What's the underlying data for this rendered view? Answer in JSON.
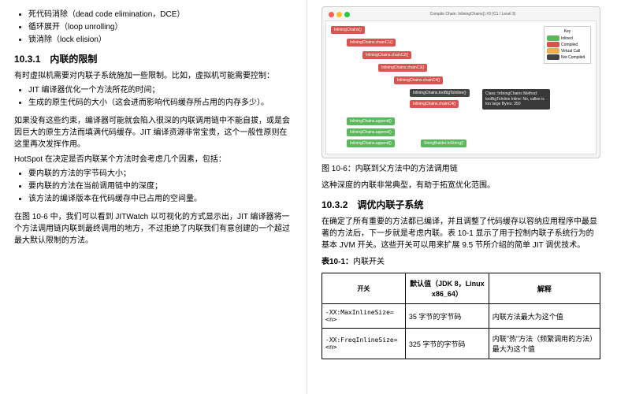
{
  "left": {
    "bullets_top": [
      "死代码消除（dead code elimination，DCE）",
      "循环展开（loop unrolling）",
      "锁消除（lock elision）"
    ],
    "h1_num": "10.3.1",
    "h1_title": "内联的限制",
    "p1": "有时虚拟机需要对内联子系统施加一些限制。比如，虚拟机可能需要控制：",
    "bullets_limits": [
      "JIT 编译器优化一个方法所花的时间；",
      "生成的原生代码的大小（这会进而影响代码缓存所占用的内存多少）。"
    ],
    "p2": "如果没有这些约束，编译器可能就会陷入很深的内联调用链中不能自拔，或是会因巨大的原生方法而填满代码缓存。JIT 编译资源非常宝贵，这个一般性原则在这里再次发挥作用。",
    "p3": "HotSpot 在决定是否内联某个方法时会考虑几个因素，包括：",
    "bullets_factors": [
      "要内联的方法的字节码大小；",
      "要内联的方法在当前调用链中的深度；",
      "该方法的编译版本在代码缓存中已占用的空间量。"
    ],
    "p4": "在图 10-6 中，我们可以看到 JITWatch 以可视化的方式显示出，JIT 编译器将一个方法调用链内联到最终调用的地方，不过拒绝了内联我们有意创建的一个超过最大默认限制的方法。"
  },
  "right": {
    "fig": {
      "title": "Compile Chain: InliningChains() #3 (C1 / Level 3)",
      "nodes": {
        "a": "InliningChains()",
        "b": "InliningChains.chainC1()",
        "c": "InliningChains.chainC2()",
        "d": "InliningChains.chainC3()",
        "e": "InliningChains.chainC4()",
        "f": "InliningChains.tooBigToInline()",
        "f2": "InliningChains.chainC4()",
        "g1": "InliningChains.append()",
        "g2": "InliningChains.append()",
        "g3": "InliningChains.append()",
        "h": "StringBuilder.toString()"
      },
      "legend": {
        "k": "Key",
        "l1": "Not Compiled",
        "l2": "Inlined",
        "l3": "Compiled",
        "l4": "Virtual Call"
      },
      "tip": "Class: InliningChains\nMethod: tooBigToInline\nInline: No, callee is too large\nBytes: 350"
    },
    "figcap_label": "图 10-6：",
    "figcap_text": "内联到父方法中的方法调用链",
    "p_after_fig": "这种深度的内联非常典型，有助于拓宽优化范围。",
    "h2_num": "10.3.2",
    "h2_title": "调优内联子系统",
    "p_tune": "在确定了所有重要的方法都已编译，并且调整了代码缓存以容纳应用程序中最显著的方法后，下一步就是考虑内联。表 10-1 显示了用于控制内联子系统行为的基本 JVM 开关。这些开关可以用来扩展 9.5 节所介绍的简单 JIT 调优技术。",
    "tablecap_label": "表10-1：",
    "tablecap_text": "内联开关",
    "th1": "开关",
    "th2": "默认值（JDK 8，Linux x86_64）",
    "th3": "解释",
    "rows": [
      {
        "c1": "-XX:MaxInlineSize=<n>",
        "c2": "35 字节的字节码",
        "c3": "内联方法最大为这个值"
      },
      {
        "c1": "-XX:FreqInlineSize=<n>",
        "c2": "325 字节的字节码",
        "c3": "内联\"热\"方法（频繁调用的方法）最大为这个值"
      }
    ]
  }
}
